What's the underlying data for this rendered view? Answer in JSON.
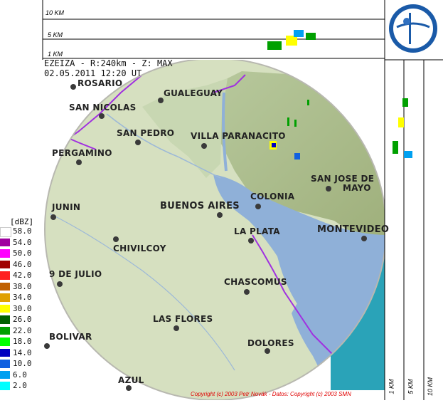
{
  "header": {
    "line1": "EZEIZA - R:240km - Z: MAX",
    "line2": "02.05.2011 12:20 UT"
  },
  "top_profile_labels": [
    "10 KM",
    "5 KM",
    "1 KM"
  ],
  "side_profile_labels": [
    "1 KM",
    "5 KM",
    "10 KM"
  ],
  "legend": {
    "title": "[dBZ]",
    "items": [
      {
        "label": "58.0",
        "color": "#ffffff"
      },
      {
        "label": "54.0",
        "color": "#a000a0"
      },
      {
        "label": "50.0",
        "color": "#ff00ff"
      },
      {
        "label": "46.0",
        "color": "#a00000"
      },
      {
        "label": "42.0",
        "color": "#ff2020"
      },
      {
        "label": "38.0",
        "color": "#c06000"
      },
      {
        "label": "34.0",
        "color": "#e0a000"
      },
      {
        "label": "30.0",
        "color": "#ffff00"
      },
      {
        "label": "26.0",
        "color": "#006000"
      },
      {
        "label": "22.0",
        "color": "#00a000"
      },
      {
        "label": "18.0",
        "color": "#00ff00"
      },
      {
        "label": "14.0",
        "color": "#0000c0"
      },
      {
        "label": "10.0",
        "color": "#1060e0"
      },
      {
        "label": "6.0",
        "color": "#00a0f0"
      },
      {
        "label": "2.0",
        "color": "#00ffff"
      }
    ]
  },
  "cities": [
    {
      "name": "ROSARIO"
    },
    {
      "name": "GUALEGUAY"
    },
    {
      "name": "SAN NICOLAS"
    },
    {
      "name": "SAN PEDRO"
    },
    {
      "name": "VILLA PARANACITO"
    },
    {
      "name": "PERGAMINO"
    },
    {
      "name": "SAN JOSE DE"
    },
    {
      "name": "MAYO"
    },
    {
      "name": "COLONIA"
    },
    {
      "name": "BUENOS AIRES"
    },
    {
      "name": "JUNIN"
    },
    {
      "name": "LA PLATA"
    },
    {
      "name": "MONTEVIDEO"
    },
    {
      "name": "CHIVILCOY"
    },
    {
      "name": "9 DE JULIO"
    },
    {
      "name": "CHASCOMUS"
    },
    {
      "name": "LAS FLORES"
    },
    {
      "name": "BOLIVAR"
    },
    {
      "name": "DOLORES"
    },
    {
      "name": "AZUL"
    }
  ],
  "copyright": "Copyright (c) 2003 Petr Novák - Datos: Copyright (c) 2003 SMN",
  "colors": {
    "water": "#8fb0d8",
    "land": "#cfdcb8",
    "outside": "#2aa3b8",
    "border": "#a030e0"
  }
}
